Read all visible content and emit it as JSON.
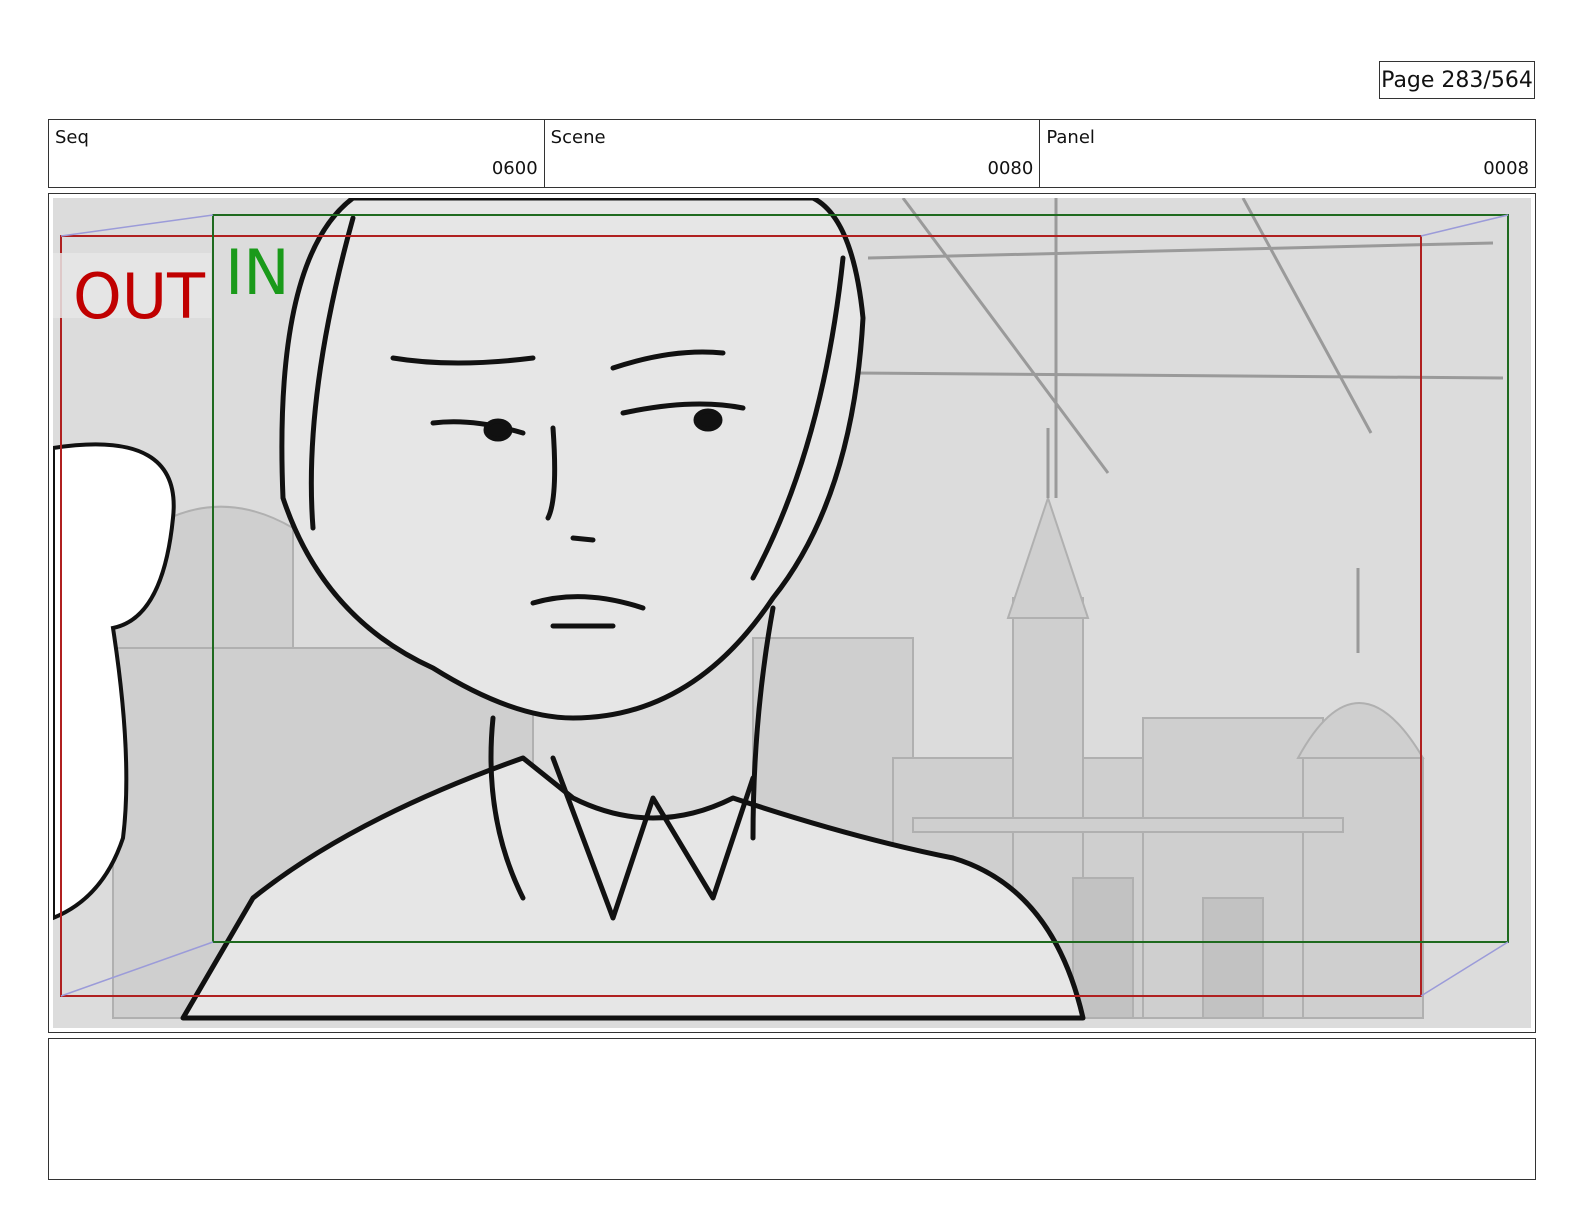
{
  "page": {
    "label": "Page 283/564"
  },
  "header": {
    "seq": {
      "label": "Seq",
      "value": "0600"
    },
    "scene": {
      "label": "Scene",
      "value": "0080"
    },
    "panel": {
      "label": "Panel",
      "value": "0008"
    }
  },
  "frame": {
    "out_label": "OUT",
    "in_label": "IN",
    "colors": {
      "out": "#c00000",
      "in": "#1a9a1a",
      "out_line": "#b02020",
      "in_line": "#1f6a1f",
      "motion_line": "#9b9bd9"
    }
  },
  "notes": {
    "text": ""
  }
}
